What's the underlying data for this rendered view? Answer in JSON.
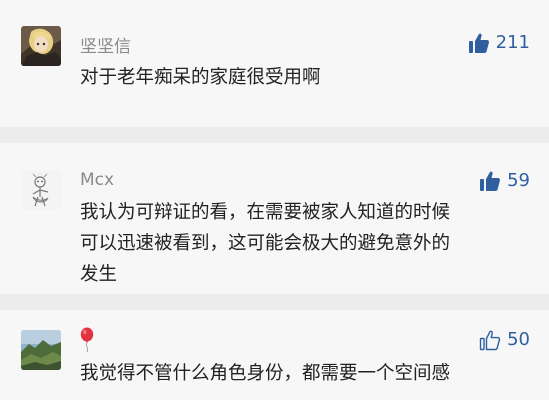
{
  "colors": {
    "page_background": "#ececec",
    "card_background": "#f7f7f7",
    "like_blue": "#2f5fa0",
    "username_gray": "#8a8a8a",
    "text_dark": "#222222"
  },
  "comments": [
    {
      "username": "坚坚信",
      "avatar": "anime-character-avatar",
      "text_lines": [
        "对于老年痴呆的家庭很受用啊"
      ],
      "likes": "211",
      "liked": true
    },
    {
      "username": "Mcx",
      "avatar": "sketch-character-avatar",
      "text_lines": [
        "我认为可辩证的看，在需要被家人知道的时候",
        "可以迅速被看到，这可能会极大的避免意外的",
        "发生"
      ],
      "likes": "59",
      "liked": true
    },
    {
      "username": "",
      "name_icon": "red-balloon-icon",
      "avatar": "landscape-photo-avatar",
      "text_lines": [
        "我觉得不管什么角色身份，都需要一个空间感"
      ],
      "likes": "50",
      "liked": false
    }
  ]
}
